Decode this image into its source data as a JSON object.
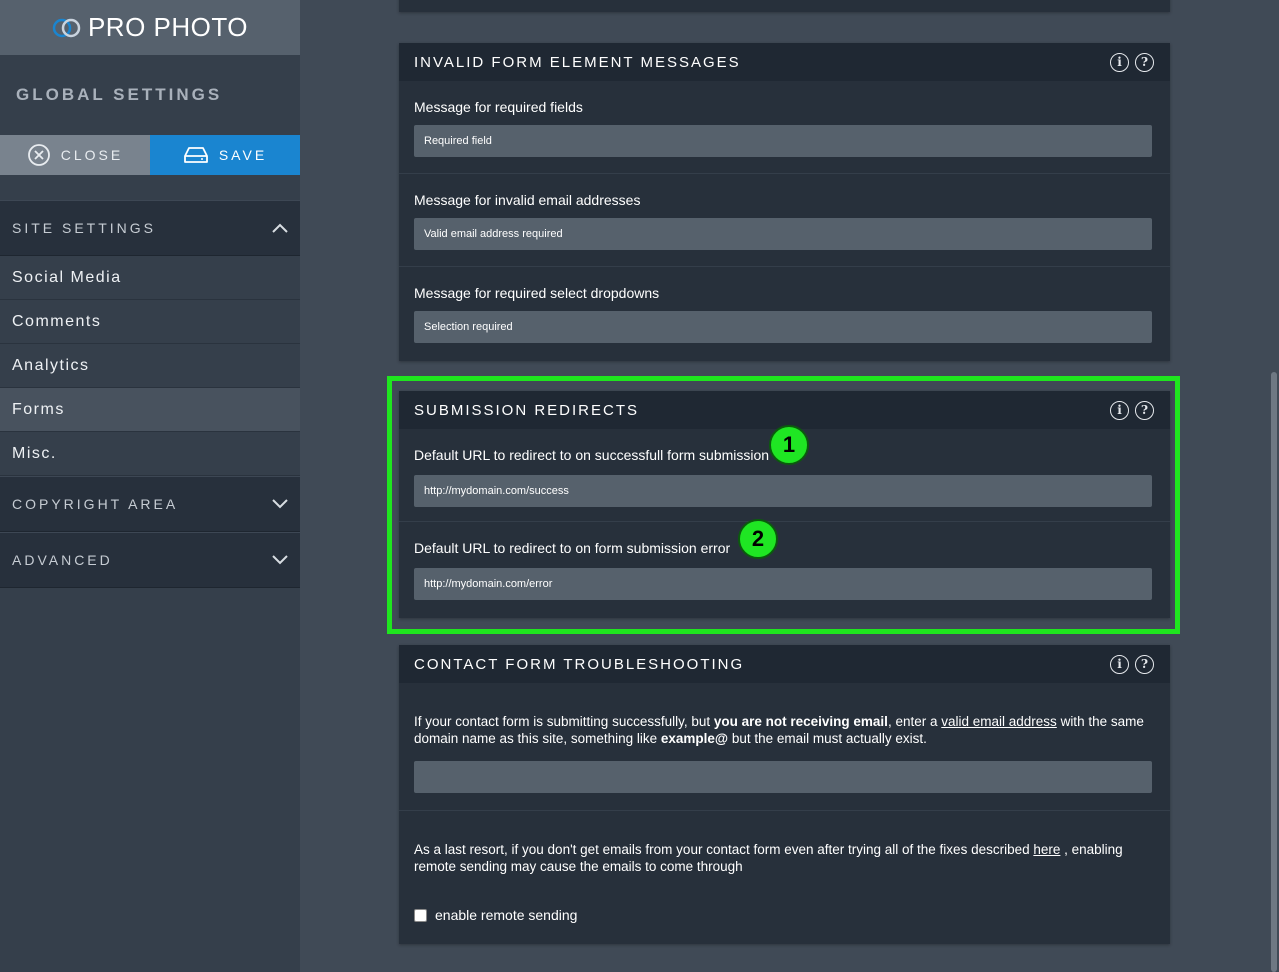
{
  "logo": {
    "text": "PRO PHOTO",
    "icon": "prophoto-rings-icon"
  },
  "sidebar": {
    "title": "GLOBAL SETTINGS",
    "close_label": "CLOSE",
    "save_label": "SAVE",
    "sections": {
      "site_settings": "SITE SETTINGS",
      "copyright_area": "COPYRIGHT AREA",
      "advanced": "ADVANCED"
    },
    "items": [
      {
        "label": "Social Media"
      },
      {
        "label": "Comments"
      },
      {
        "label": "Analytics"
      },
      {
        "label": "Forms"
      },
      {
        "label": "Misc."
      }
    ],
    "active_item": "Forms"
  },
  "invalid_messages": {
    "title": "INVALID FORM ELEMENT MESSAGES",
    "fields": [
      {
        "label": "Message for required fields",
        "value": "Required field"
      },
      {
        "label": "Message for invalid email addresses",
        "value": "Valid email address required"
      },
      {
        "label": "Message for required select dropdowns",
        "value": "Selection required"
      }
    ]
  },
  "redirects": {
    "title": "SUBMISSION REDIRECTS",
    "fields": [
      {
        "label": "Default URL to redirect to on successfull form submission",
        "value": "http://mydomain.com/success",
        "badge": "1"
      },
      {
        "label": "Default URL to redirect to on form submission error",
        "value": "http://mydomain.com/error",
        "badge": "2"
      }
    ]
  },
  "troubleshooting": {
    "title": "CONTACT FORM TROUBLESHOOTING",
    "p1_a": "If your contact form is submitting successfully, but ",
    "p1_b": "you are not receiving email",
    "p1_c": ", enter a ",
    "p1_link": "valid email address",
    "p1_d": " with the same domain name as this site, something like ",
    "p1_e": "example@",
    "p1_f": " but the email must actually exist.",
    "email_value": "",
    "p2_a": "As a last resort, if you don't get emails from your contact form even after trying all of the fixes described ",
    "p2_link": "here",
    "p2_b": " , enabling remote sending may cause the emails to come through",
    "checkbox_label": "enable remote sending",
    "checkbox_checked": false
  },
  "colors": {
    "accent_save": "#1a85d0",
    "highlight": "#1fe61f",
    "sidebar_bg": "#353f4b",
    "main_bg": "#404a56"
  }
}
